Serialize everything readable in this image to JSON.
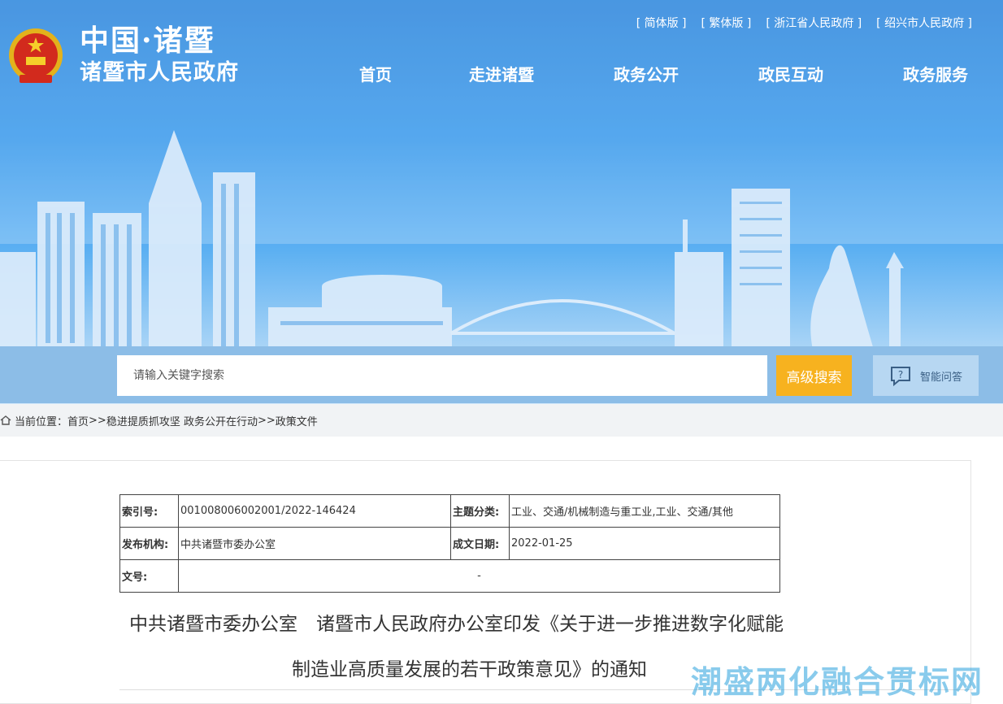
{
  "header": {
    "logo_line1": "中国·诸暨",
    "logo_line2": "诸暨市人民政府",
    "top_links": [
      "[ 简体版 ]",
      "[ 繁体版 ]",
      "[ 浙江省人民政府 ]",
      "[ 绍兴市人民政府 ]"
    ],
    "nav": [
      "首页",
      "走进诸暨",
      "政务公开",
      "政民互动",
      "政务服务"
    ]
  },
  "search": {
    "placeholder": "请输入关键字搜索",
    "advanced_label": "高级搜索",
    "ai_label": "智能问答"
  },
  "breadcrumb": {
    "prefix": "当前位置：",
    "items": [
      "首页",
      "稳进提质抓攻坚 政务公开在行动",
      "政策文件"
    ],
    "separator": ">>"
  },
  "meta": {
    "index_label": "索引号:",
    "index_value": "001008006002001/2022-146424",
    "topic_label": "主题分类:",
    "topic_value": "工业、交通/机械制造与重工业,工业、交通/其他",
    "publisher_label": "发布机构:",
    "publisher_value": "中共诸暨市委办公室",
    "date_label": "成文日期:",
    "date_value": "2022-01-25",
    "docno_label": "文号:",
    "docno_value": "-"
  },
  "document": {
    "title_line1": "中共诸暨市委办公室　诸暨市人民政府办公室印发《关于进一步推进数字化赋能",
    "title_line2": "制造业高质量发展的若干政策意见》的通知"
  },
  "watermark": "潮盛两化融合贯标网",
  "colors": {
    "banner_top": "#1679d8",
    "search_band": "#8cbde7",
    "advanced_button": "#f7b21f",
    "breadcrumb_bg": "#f1f3f5"
  }
}
